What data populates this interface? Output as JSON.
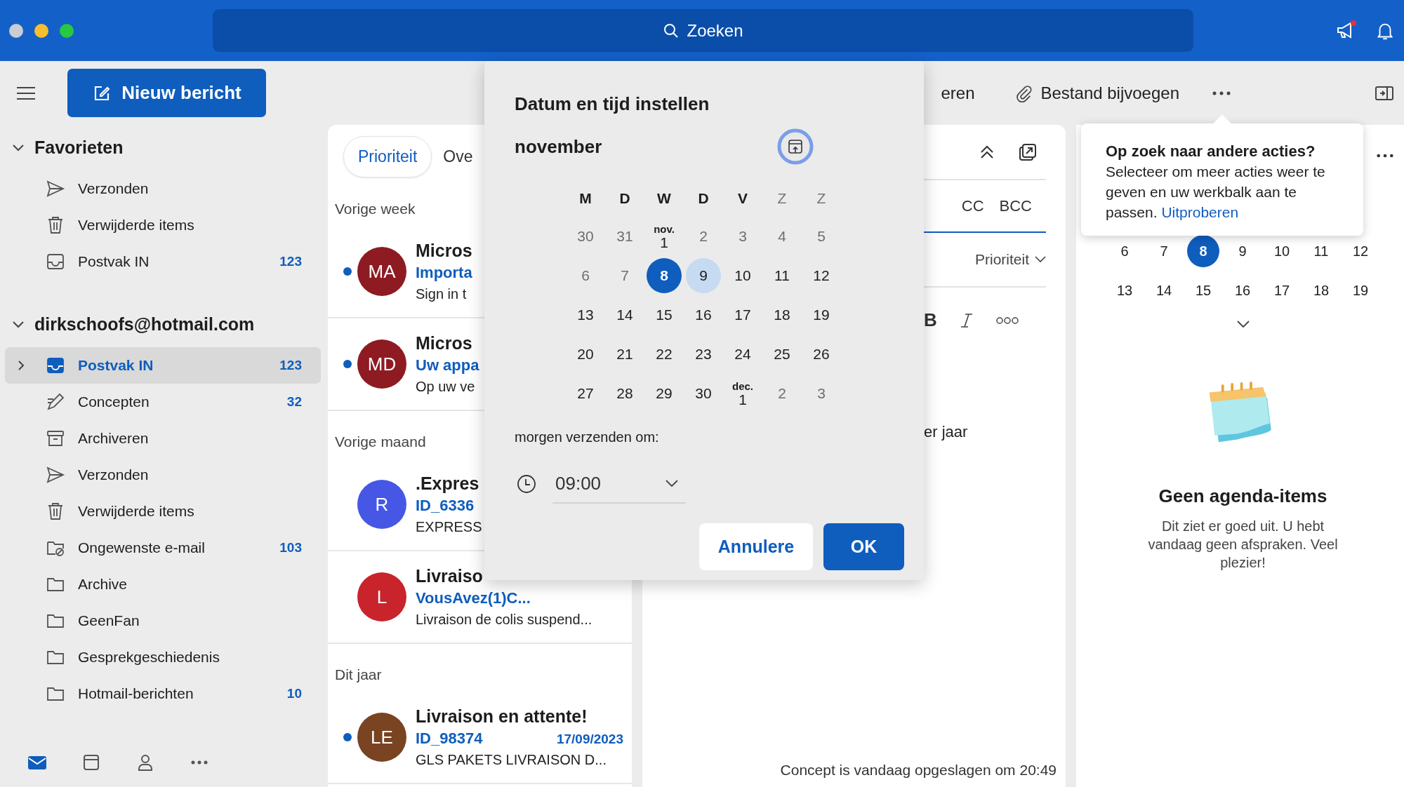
{
  "search": {
    "placeholder": "Zoeken"
  },
  "toolbar": {
    "new_message": "Nieuw bericht",
    "actions": [
      {
        "label": "eren",
        "kind": "text"
      },
      {
        "label": "Bestand bijvoegen",
        "kind": "attach"
      }
    ]
  },
  "sidebar": {
    "groups": [
      {
        "title": "Favorieten",
        "expanded": true,
        "items": [
          {
            "label": "Verzonden",
            "kind": "send",
            "selected": false,
            "expandable": false
          },
          {
            "label": "Verwijderde items",
            "kind": "trash",
            "selected": false,
            "expandable": false
          },
          {
            "label": "Postvak IN",
            "kind": "inbox",
            "count": "123",
            "selected": false,
            "expandable": false
          }
        ]
      },
      {
        "title": "dirkschoofs@hotmail.com",
        "expanded": true,
        "items": [
          {
            "label": "Postvak IN",
            "kind": "inbox",
            "count": "123",
            "selected": true,
            "expandable": true
          },
          {
            "label": "Concepten",
            "kind": "drafts",
            "count": "32",
            "selected": false,
            "expandable": false
          },
          {
            "label": "Archiveren",
            "kind": "archive",
            "selected": false,
            "expandable": false
          },
          {
            "label": "Verzonden",
            "kind": "send",
            "selected": false,
            "expandable": false
          },
          {
            "label": "Verwijderde items",
            "kind": "trash",
            "selected": false,
            "expandable": false
          },
          {
            "label": "Ongewenste e-mail",
            "kind": "junk",
            "count": "103",
            "selected": false,
            "expandable": false
          },
          {
            "label": "Archive",
            "kind": "folder",
            "selected": false,
            "expandable": false
          },
          {
            "label": "GeenFan",
            "kind": "folder",
            "selected": false,
            "expandable": false
          },
          {
            "label": "Gesprekgeschiedenis",
            "kind": "folder",
            "selected": false,
            "expandable": false
          },
          {
            "label": "Hotmail-berichten",
            "kind": "folder",
            "count": "10",
            "selected": false,
            "expandable": false
          }
        ]
      }
    ],
    "nav": [
      {
        "kind": "mail",
        "selected": true
      },
      {
        "kind": "calendar",
        "selected": false
      },
      {
        "kind": "people",
        "selected": false
      },
      {
        "kind": "more",
        "selected": false
      }
    ]
  },
  "message_list": {
    "tabs": [
      {
        "label": "Prioriteit",
        "selected": true
      },
      {
        "label": "Ove",
        "selected": false
      }
    ],
    "sections": [
      {
        "title": "Vorige week",
        "messages": [
          {
            "initials": "MA",
            "color": "#8e1b22",
            "unread": true,
            "sender": "Micros",
            "subject": "Importa",
            "preview": "Sign in t"
          },
          {
            "initials": "MD",
            "color": "#8e1b22",
            "unread": true,
            "sender": "Micros",
            "subject": "Uw appa",
            "preview": "Op uw ve"
          }
        ]
      },
      {
        "title": "Vorige maand",
        "messages": [
          {
            "initials": "R",
            "color": "#4657e6",
            "unread": false,
            "sender": ".Expres",
            "subject": "ID_6336",
            "preview": "EXPRESS"
          },
          {
            "initials": "L",
            "color": "#c9232c",
            "unread": false,
            "sender": "Livraiso",
            "subject": "VousAvez(1)C...",
            "preview": "Livraison de colis suspend..."
          }
        ]
      },
      {
        "title": "Dit jaar",
        "messages": [
          {
            "initials": "LE",
            "color": "#7a4321",
            "unread": true,
            "sender": "Livraison en attente!",
            "subject": "ID_98374",
            "date": "17/09/2023",
            "preview": "GLS PAKETS LIVRAISON D..."
          }
        ]
      }
    ]
  },
  "compose": {
    "cc": "CC",
    "bcc": "BCC",
    "priority": "Prioriteit",
    "bold": "B",
    "body_fragment": "er jaar",
    "status": "Concept is vandaag opgeslagen om 20:49"
  },
  "dialog": {
    "title": "Datum en tijd instellen",
    "month": "november",
    "weekdays": [
      {
        "label": "M",
        "muted": false
      },
      {
        "label": "D",
        "muted": false
      },
      {
        "label": "W",
        "muted": false
      },
      {
        "label": "D",
        "muted": false
      },
      {
        "label": "V",
        "muted": false
      },
      {
        "label": "Z",
        "muted": true
      },
      {
        "label": "Z",
        "muted": true
      }
    ],
    "weeks": [
      [
        {
          "day": "30",
          "muted": true,
          "selected": false,
          "highlighted": false
        },
        {
          "day": "31",
          "muted": true,
          "selected": false,
          "highlighted": false
        },
        {
          "day": "1",
          "month_label": "nov.",
          "muted": false,
          "selected": false,
          "highlighted": false
        },
        {
          "day": "2",
          "muted": true,
          "selected": false,
          "highlighted": false
        },
        {
          "day": "3",
          "muted": true,
          "selected": false,
          "highlighted": false
        },
        {
          "day": "4",
          "muted": true,
          "selected": false,
          "highlighted": false
        },
        {
          "day": "5",
          "muted": true,
          "selected": false,
          "highlighted": false
        }
      ],
      [
        {
          "day": "6",
          "muted": true,
          "selected": false,
          "highlighted": false
        },
        {
          "day": "7",
          "muted": true,
          "selected": false,
          "highlighted": false
        },
        {
          "day": "8",
          "muted": false,
          "selected": true,
          "highlighted": false
        },
        {
          "day": "9",
          "muted": false,
          "selected": false,
          "highlighted": true
        },
        {
          "day": "10",
          "muted": false,
          "selected": false,
          "highlighted": false
        },
        {
          "day": "11",
          "muted": false,
          "selected": false,
          "highlighted": false
        },
        {
          "day": "12",
          "muted": false,
          "selected": false,
          "highlighted": false
        }
      ],
      [
        {
          "day": "13",
          "muted": false,
          "selected": false,
          "highlighted": false
        },
        {
          "day": "14",
          "muted": false,
          "selected": false,
          "highlighted": false
        },
        {
          "day": "15",
          "muted": false,
          "selected": false,
          "highlighted": false
        },
        {
          "day": "16",
          "muted": false,
          "selected": false,
          "highlighted": false
        },
        {
          "day": "17",
          "muted": false,
          "selected": false,
          "highlighted": false
        },
        {
          "day": "18",
          "muted": false,
          "selected": false,
          "highlighted": false
        },
        {
          "day": "19",
          "muted": false,
          "selected": false,
          "highlighted": false
        }
      ],
      [
        {
          "day": "20",
          "muted": false,
          "selected": false,
          "highlighted": false
        },
        {
          "day": "21",
          "muted": false,
          "selected": false,
          "highlighted": false
        },
        {
          "day": "22",
          "muted": false,
          "selected": false,
          "highlighted": false
        },
        {
          "day": "23",
          "muted": false,
          "selected": false,
          "highlighted": false
        },
        {
          "day": "24",
          "muted": false,
          "selected": false,
          "highlighted": false
        },
        {
          "day": "25",
          "muted": false,
          "selected": false,
          "highlighted": false
        },
        {
          "day": "26",
          "muted": false,
          "selected": false,
          "highlighted": false
        }
      ],
      [
        {
          "day": "27",
          "muted": false,
          "selected": false,
          "highlighted": false
        },
        {
          "day": "28",
          "muted": false,
          "selected": false,
          "highlighted": false
        },
        {
          "day": "29",
          "muted": false,
          "selected": false,
          "highlighted": false
        },
        {
          "day": "30",
          "muted": false,
          "selected": false,
          "highlighted": false
        },
        {
          "day": "1",
          "month_label": "dec.",
          "muted": false,
          "selected": false,
          "highlighted": false
        },
        {
          "day": "2",
          "muted": true,
          "selected": false,
          "highlighted": false
        },
        {
          "day": "3",
          "muted": true,
          "selected": false,
          "highlighted": false
        }
      ]
    ],
    "time_label": "morgen verzenden om:",
    "time": "09:00",
    "buttons": [
      {
        "label": "Annulere",
        "kind": "secondary"
      },
      {
        "label": "OK",
        "kind": "primary"
      }
    ]
  },
  "tooltip": {
    "title": "Op zoek naar andere acties?",
    "body": "Selecteer om meer acties weer te geven en uw werkbalk aan te passen.",
    "link": "Uitproberen"
  },
  "agenda": {
    "weeks": [
      [
        {
          "day": "6",
          "selected": false
        },
        {
          "day": "7",
          "selected": false
        },
        {
          "day": "8",
          "selected": true
        },
        {
          "day": "9",
          "selected": false
        },
        {
          "day": "10",
          "selected": false
        },
        {
          "day": "11",
          "selected": false
        },
        {
          "day": "12",
          "selected": false
        }
      ],
      [
        {
          "day": "13",
          "selected": false
        },
        {
          "day": "14",
          "selected": false
        },
        {
          "day": "15",
          "selected": false
        },
        {
          "day": "16",
          "selected": false
        },
        {
          "day": "17",
          "selected": false
        },
        {
          "day": "18",
          "selected": false
        },
        {
          "day": "19",
          "selected": false
        }
      ]
    ],
    "empty_title": "Geen agenda-items",
    "empty_text": "Dit ziet er goed uit. U hebt vandaag geen afspraken. Veel plezier!"
  }
}
